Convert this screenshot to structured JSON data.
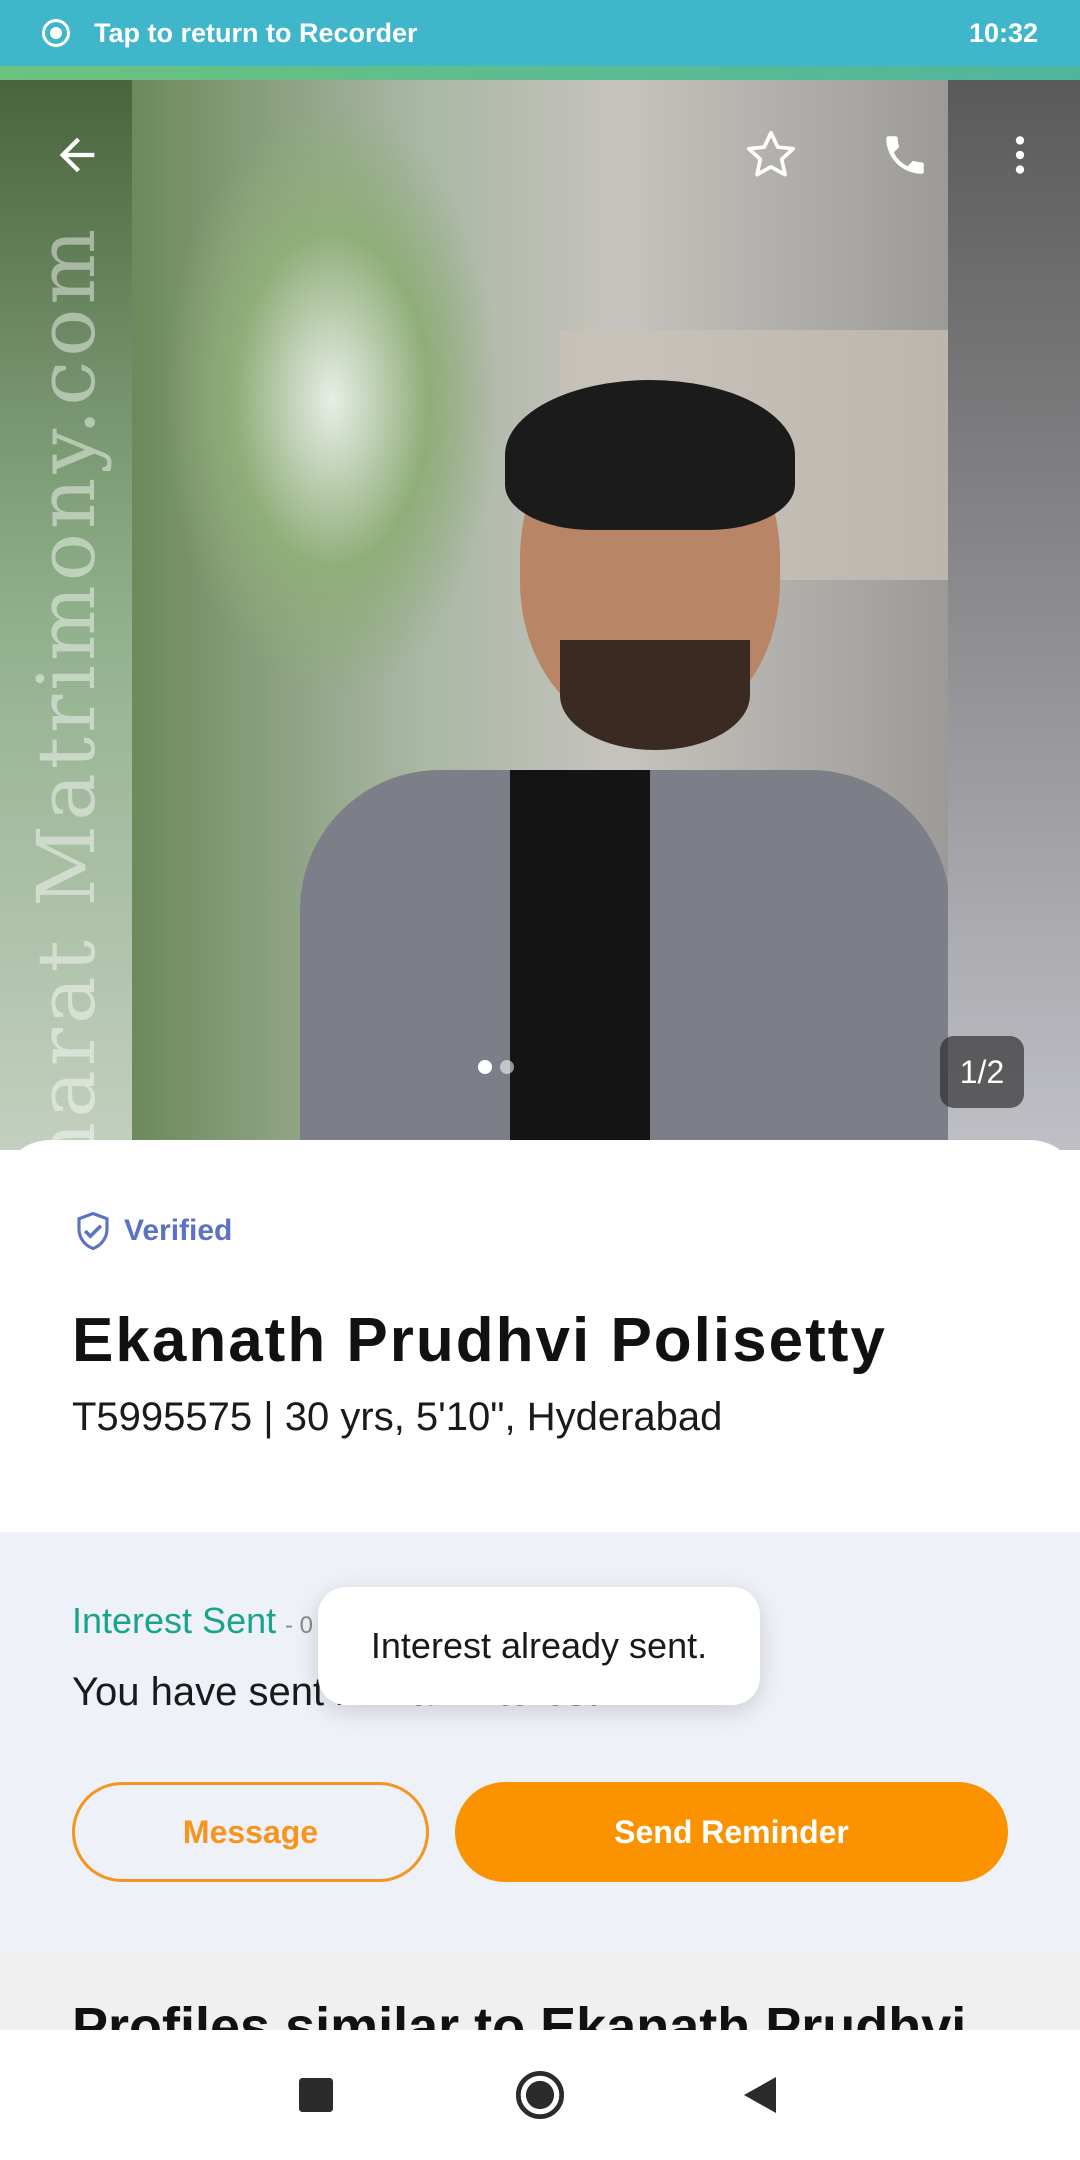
{
  "status_bar": {
    "recorder_text": "Tap to return to Recorder",
    "time": "10:32"
  },
  "photo": {
    "watermark": "Bharat Matrimony.com",
    "counter": "1/2",
    "icons": [
      "back-arrow-icon",
      "star-icon",
      "phone-icon",
      "more-vert-icon"
    ]
  },
  "profile": {
    "verified_label": "Verified",
    "name": "Ekanath Prudhvi Polisetty",
    "meta": "T5995575 | 30 yrs, 5'10\", Hyderabad"
  },
  "interest": {
    "status": "Interest Sent",
    "status_date": "- 0",
    "description": "You have sent him an interest.",
    "message_button": "Message",
    "reminder_button": "Send Reminder"
  },
  "toast": {
    "text": "Interest already sent."
  },
  "similar": {
    "heading": "Profiles similar to Ekanath Prudhvi"
  },
  "colors": {
    "status_bar": "#3fb6c9",
    "accent_orange": "#fb9200",
    "verified_blue": "#5b73c2",
    "interest_green": "#1aa48c"
  }
}
